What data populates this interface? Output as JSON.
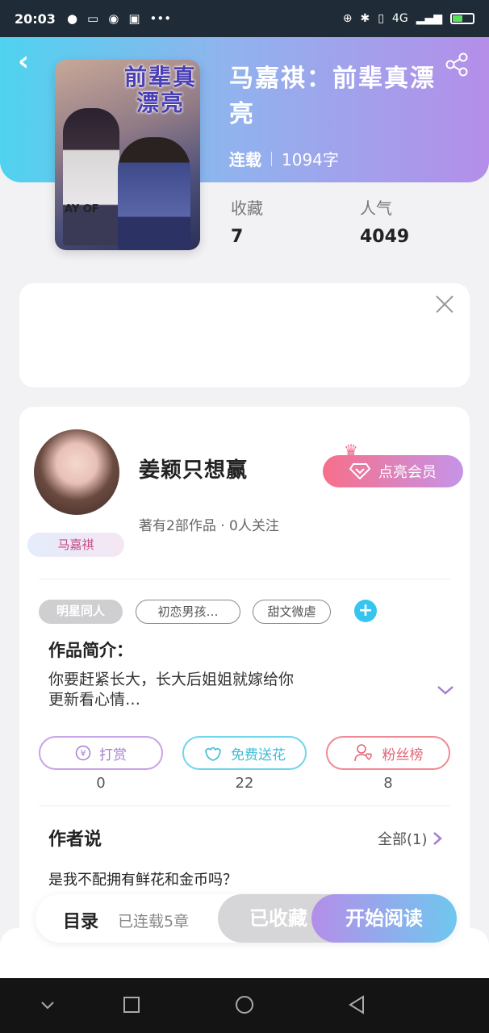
{
  "status_bar": {
    "time": "20:03",
    "network": "4G",
    "battery_level": 0.5
  },
  "header": {
    "back_icon": "back-arrow-icon",
    "share_icon": "share-icon"
  },
  "book": {
    "cover_title": "前辈真漂亮",
    "cover_shirt_text": "AY OF",
    "title": "马嘉祺：前辈真漂亮",
    "status": "连载",
    "word_count": "1094字",
    "stats": [
      {
        "label": "收藏",
        "value": "7"
      },
      {
        "label": "人气",
        "value": "4049"
      }
    ]
  },
  "author": {
    "name": "姜颖只想赢",
    "works_info": "著有2部作品 · 0人关注",
    "badge": "马嘉祺",
    "vip_button": "点亮会员"
  },
  "tags": [
    "明星同人",
    "初恋男孩…",
    "甜文微虐"
  ],
  "intro": {
    "label": "作品简介：",
    "text": "你要赶紧长大，长大后姐姐就嫁给你\n更新看心情…"
  },
  "actions": [
    {
      "label": "打赏",
      "count": "0",
      "icon": "yen-icon"
    },
    {
      "label": "免费送花",
      "count": "22",
      "icon": "flower-icon"
    },
    {
      "label": "粉丝榜",
      "count": "8",
      "icon": "fan-icon"
    }
  ],
  "author_say": {
    "label": "作者说",
    "all": "全部(1)",
    "text": "是我不配拥有鲜花和金币吗？"
  },
  "bottom_bar": {
    "catalog": "目录",
    "catalog_sub": "已连载5章",
    "collected": "已收藏",
    "read": "开始阅读"
  },
  "colors": {
    "header_gradient_start": "#4fd3ef",
    "header_gradient_end": "#b48ee9",
    "vip_start": "#f76f8a",
    "vip_end": "#c594e8",
    "read_start": "#b48ee9",
    "read_end": "#6fc7ef"
  }
}
